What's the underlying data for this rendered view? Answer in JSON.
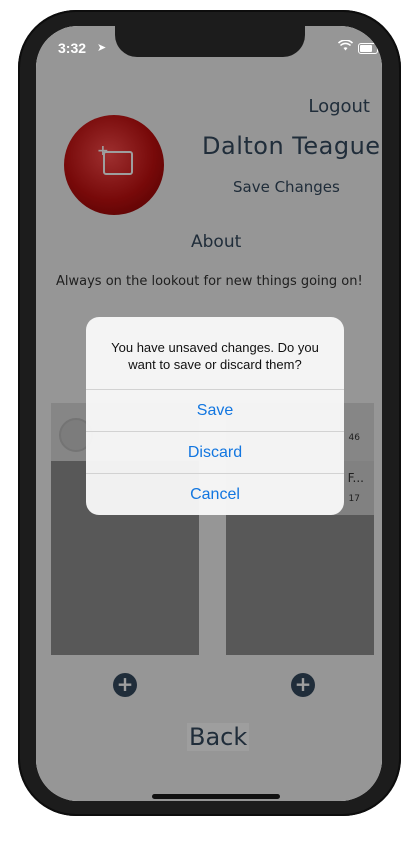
{
  "status_bar": {
    "time": "3:32",
    "location_icon": "location-arrow-icon",
    "wifi_icon": "wifi-icon",
    "battery_icon": "battery-icon"
  },
  "header": {
    "logout_label": "Logout"
  },
  "profile": {
    "name": "Dalton Teague",
    "save_changes_label": "Save Changes",
    "avatar_icon": "add-photo-icon"
  },
  "about": {
    "heading": "About",
    "bio": "Always on the lookout for new things going on!"
  },
  "cards": {
    "left": {
      "icon": "person-icon"
    },
    "right": {
      "count_top": "46",
      "text_truncated": "F...",
      "count_bottom": "17"
    }
  },
  "add_buttons": {
    "icon": "plus-circle-icon"
  },
  "footer": {
    "back_label": "Back"
  },
  "alert": {
    "message": "You have unsaved changes. Do you want to save or discard them?",
    "save_label": "Save",
    "discard_label": "Discard",
    "cancel_label": "Cancel",
    "accent_color": "#1276e0"
  },
  "colors": {
    "text_primary": "#34495e",
    "avatar": "#c21010",
    "overlay": "rgba(0,0,0,0.38)"
  }
}
